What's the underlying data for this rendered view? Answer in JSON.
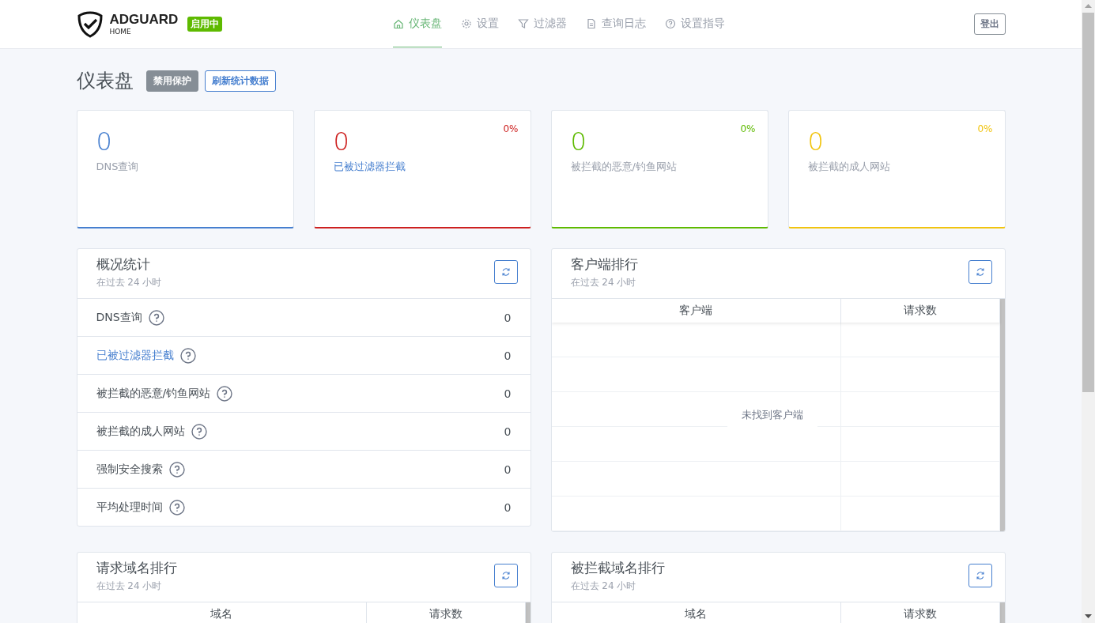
{
  "header": {
    "brand": "ADGUARD",
    "brand_sub": "HOME",
    "status_badge": "启用中",
    "nav": [
      {
        "label": "仪表盘",
        "selected": true
      },
      {
        "label": "设置",
        "selected": false
      },
      {
        "label": "过滤器",
        "selected": false
      },
      {
        "label": "查询日志",
        "selected": false
      },
      {
        "label": "设置指导",
        "selected": false
      }
    ],
    "logout": "登出"
  },
  "page": {
    "title": "仪表盘",
    "buttons": [
      {
        "label": "禁用保护",
        "kind": "solid"
      },
      {
        "label": "刷新统计数据",
        "kind": "outline"
      }
    ]
  },
  "stat_cards": [
    {
      "value": "0",
      "label": "DNS查询",
      "color": "#467fcf",
      "link": false
    },
    {
      "value": "0",
      "label": "已被过滤器拦截",
      "percent": "0%",
      "color": "#cd201f",
      "link": true
    },
    {
      "value": "0",
      "label": "被拦截的恶意/钓鱼网站",
      "percent": "0%",
      "color": "#5eba00",
      "link": false
    },
    {
      "value": "0",
      "label": "被拦截的成人网站",
      "percent": "0%",
      "color": "#f1c40f",
      "link": false
    }
  ],
  "overview": {
    "title": "概况统计",
    "subtitle": "在过去 24 小时",
    "rows": [
      {
        "label": "DNS查询",
        "value": "0",
        "link": false
      },
      {
        "label": "已被过滤器拦截",
        "value": "0",
        "link": true
      },
      {
        "label": "被拦截的恶意/钓鱼网站",
        "value": "0",
        "link": false
      },
      {
        "label": "被拦截的成人网站",
        "value": "0",
        "link": false
      },
      {
        "label": "强制安全搜索",
        "value": "0",
        "link": false
      },
      {
        "label": "平均处理时间",
        "value": "0",
        "link": false
      }
    ]
  },
  "top_clients": {
    "title": "客户端排行",
    "subtitle": "在过去 24 小时",
    "columns": [
      "客户端",
      "请求数"
    ],
    "empty_message": "未找到客户端"
  },
  "top_queried": {
    "title": "请求域名排行",
    "subtitle": "在过去 24 小时",
    "columns": [
      "域名",
      "请求数"
    ]
  },
  "top_blocked": {
    "title": "被拦截域名排行",
    "subtitle": "在过去 24 小时",
    "columns": [
      "域名",
      "请求数"
    ]
  }
}
